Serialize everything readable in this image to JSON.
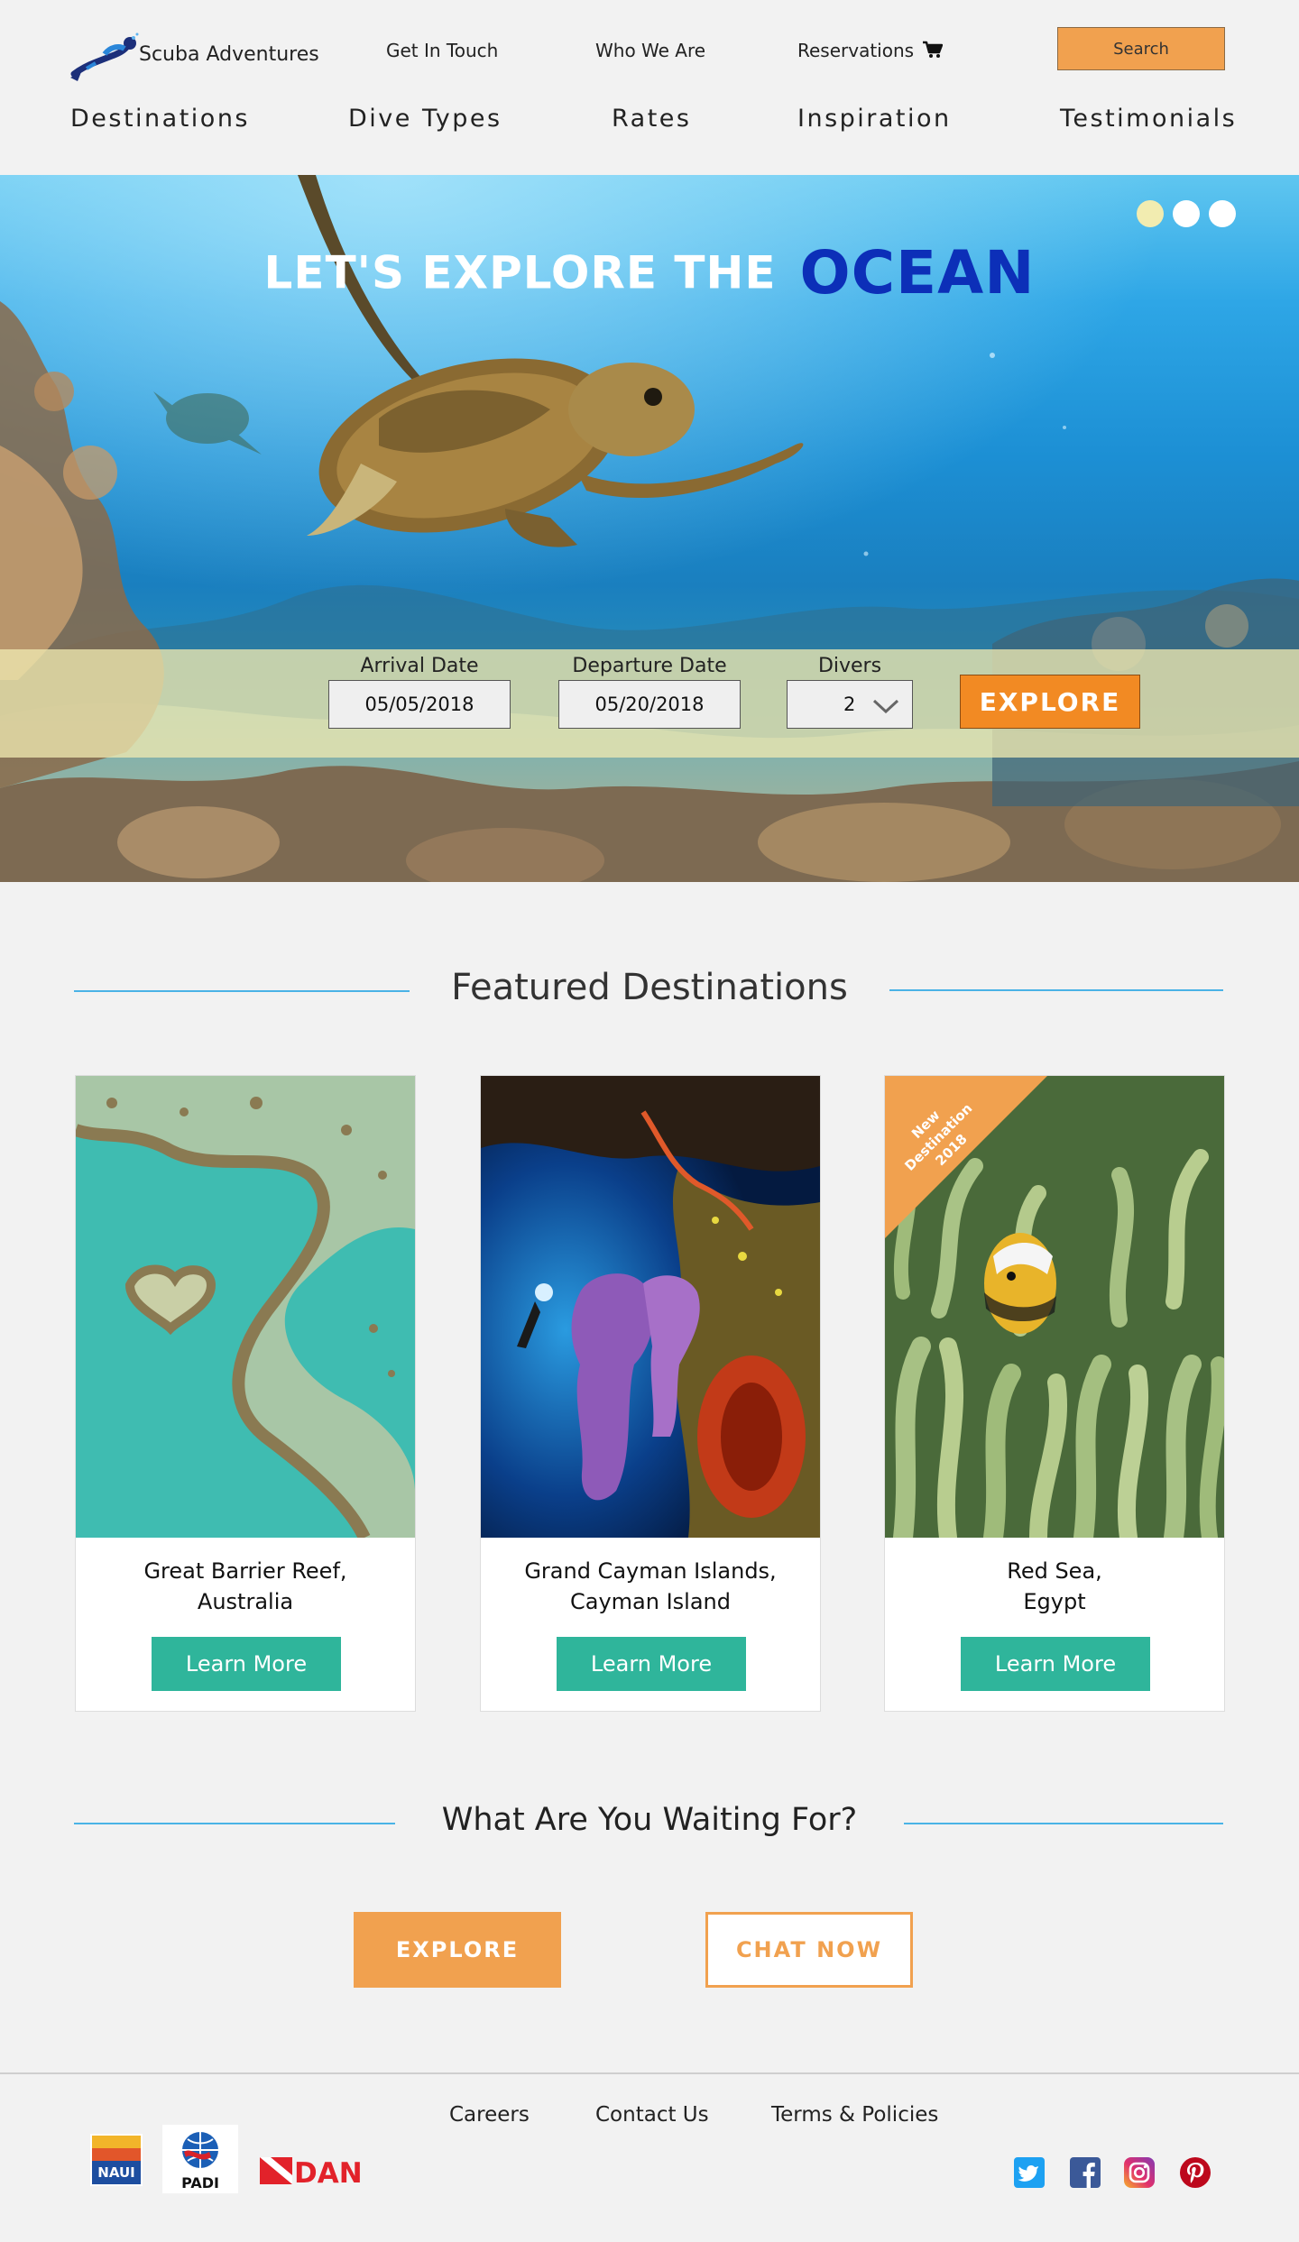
{
  "header": {
    "brand": "Scuba Adventures",
    "top_links": [
      "Get In Touch",
      "Who We Are",
      "Reservations"
    ],
    "search_label": "Search",
    "main_nav": [
      "Destinations",
      "Dive Types",
      "Rates",
      "Inspiration",
      "Testimonials"
    ]
  },
  "hero": {
    "title_lead": "LET'S EXPLORE THE",
    "title_accent": "OCEAN",
    "carousel_dots": 3,
    "carousel_active_index": 0,
    "booking": {
      "arrival_label": "Arrival Date",
      "arrival_value": "05/05/2018",
      "departure_label": "Departure Date",
      "departure_value": "05/20/2018",
      "divers_label": "Divers",
      "divers_value": "2",
      "explore_label": "EXPLORE"
    }
  },
  "featured": {
    "heading": "Featured Destinations",
    "cards": [
      {
        "title_line1": "Great Barrier Reef,",
        "title_line2": "Australia",
        "button": "Learn More"
      },
      {
        "title_line1": "Grand Cayman Islands,",
        "title_line2": "Cayman Island",
        "button": "Learn More"
      },
      {
        "title_line1": "Red Sea,",
        "title_line2": "Egypt",
        "button": "Learn More",
        "ribbon_line1": "New",
        "ribbon_line2": "Destination",
        "ribbon_line3": "2018"
      }
    ]
  },
  "cta": {
    "heading": "What Are You Waiting For?",
    "explore_label": "EXPLORE",
    "chat_label": "CHAT NOW"
  },
  "footer": {
    "links": [
      "Careers",
      "Contact Us",
      "Terms & Policies"
    ],
    "badges": {
      "naui": "NAUI",
      "padi": "PADI",
      "dan": "DAN"
    },
    "social": [
      "twitter-icon",
      "facebook-icon",
      "instagram-icon",
      "pinterest-icon"
    ]
  },
  "colors": {
    "accent_orange": "#f1a14f",
    "explore_orange": "#f28a23",
    "teal": "#2fb59b",
    "ocean_blue": "#0c2fb8",
    "line_blue": "#4ab3e6"
  }
}
